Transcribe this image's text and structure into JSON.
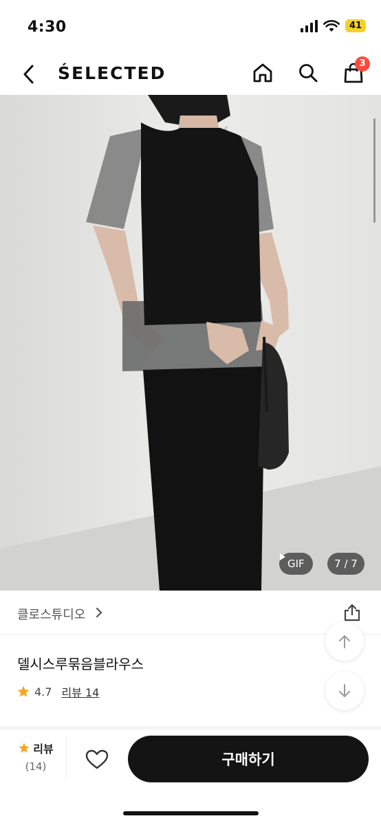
{
  "status_bar": {
    "time": "4:30",
    "battery": "41"
  },
  "header": {
    "brand": "ŚELECTED",
    "cart_count": "3",
    "icons": [
      "chevron-left-icon",
      "home-icon",
      "search-icon",
      "shopping-bag-icon"
    ]
  },
  "gallery": {
    "media_type": "GIF",
    "counter": "7 / 7"
  },
  "store": {
    "name": "클로스튜디오"
  },
  "product": {
    "title": "델시스루묶음블라우스",
    "rating": "4.7",
    "review_link": "리뷰 14"
  },
  "bottom_bar": {
    "review_label": "리뷰",
    "review_count": "(14)",
    "buy_label": "구매하기"
  },
  "colors": {
    "accent_star": "#f5a623",
    "badge": "#ff4a3d",
    "buy_button": "#141414",
    "battery": "#f4d12a"
  }
}
